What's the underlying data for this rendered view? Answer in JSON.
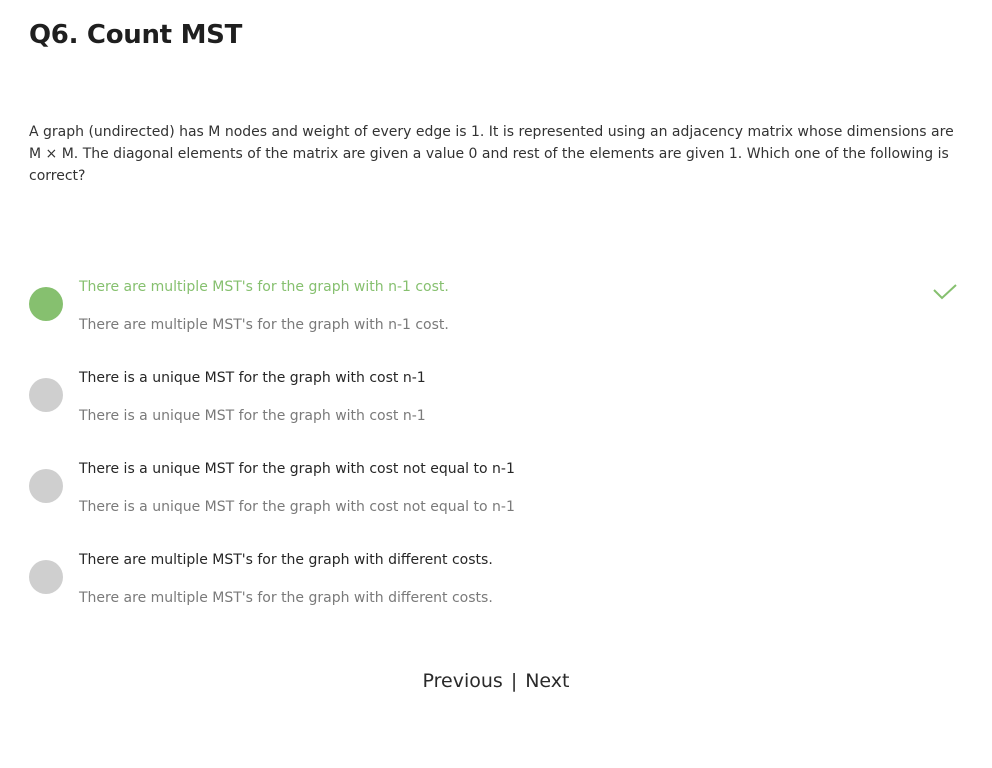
{
  "question": {
    "title": "Q6. Count MST",
    "text": "A graph (undirected) has M nodes and weight of every edge is 1. It is represented using an adjacency matrix whose dimensions are M × M. The diagonal elements of the matrix are given a value 0 and rest of the elements are given 1. Which one of the following is correct?"
  },
  "options": [
    {
      "label": "There are multiple MST's for the graph with n-1 cost.",
      "description": "There are multiple MST's for the graph with n-1 cost."
    },
    {
      "label": "There is a unique MST for the graph with cost n-1",
      "description": "There is a unique MST for the graph with cost n-1"
    },
    {
      "label": "There is a unique MST for the graph with cost not equal to n-1",
      "description": "There is a unique MST for the graph with cost not equal to n-1"
    },
    {
      "label": "There are multiple MST's for the graph with different costs.",
      "description": "There are multiple MST's for the graph with different costs."
    }
  ],
  "selected_option": 0,
  "correct_icon": "checkmark-icon",
  "colors": {
    "correct": "#86c06f",
    "radio_unselected": "#cfcfcf"
  },
  "navigation": {
    "previous": "Previous",
    "separator": "|",
    "next": "Next"
  }
}
